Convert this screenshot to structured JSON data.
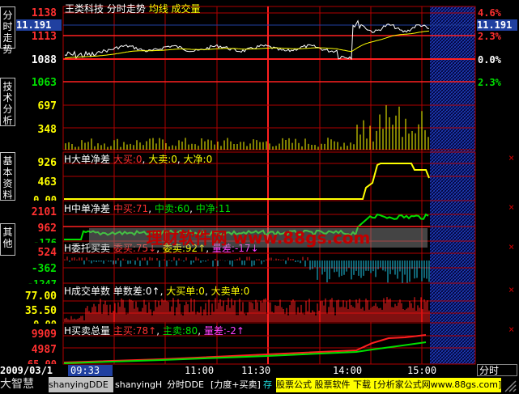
{
  "header": {
    "stock_name": "王类科技",
    "tab_timeshare": "分时走势",
    "legend_avg": "均线",
    "legend_volume": "成交量",
    "top_price": "1138",
    "top_pct": "4.6%",
    "cursor_price_left": "11.191",
    "cursor_price_right": "11.191"
  },
  "side_tabs": [
    {
      "label": "分时走势"
    },
    {
      "label": "技术分析"
    },
    {
      "label": "基本资料"
    },
    {
      "label": "其他"
    }
  ],
  "price_panel": {
    "y_labels": [
      "1113",
      "1088",
      "1063"
    ],
    "right_labels": [
      "2.3%",
      "0.0%",
      "2.3%"
    ],
    "colors": {
      "up": "#ff3030",
      "flat": "#ffffff",
      "down": "#00e000"
    }
  },
  "volume_panel": {
    "y_labels": [
      "697",
      "348"
    ]
  },
  "indicators": {
    "big_net": {
      "title": "H大单净差",
      "items": [
        {
          "label": "大买:",
          "value": "0"
        },
        {
          "label": "大卖:",
          "value": "0"
        },
        {
          "label": "大净:",
          "value": "0"
        }
      ],
      "y_labels": [
        "926",
        "463",
        "0.00"
      ]
    },
    "mid_net": {
      "title": "H中单净差",
      "items": [
        {
          "label": "中买:",
          "value": "71"
        },
        {
          "label": "中卖:",
          "value": "60"
        },
        {
          "label": "中净:",
          "value": "11"
        }
      ],
      "y_labels": [
        "2101",
        "962",
        "-176"
      ]
    },
    "entrust": {
      "title": "H委托买卖",
      "items": [
        {
          "label": "委买:",
          "value": "75↓"
        },
        {
          "label": "委卖:",
          "value": "92↑"
        },
        {
          "label": "量差:",
          "value": "-17↓"
        }
      ],
      "y_labels": [
        "524",
        "-362",
        "-1247"
      ]
    },
    "deal_count": {
      "title": "H成交单数",
      "items": [
        {
          "label": "单数差:",
          "value": "0↑"
        },
        {
          "label": "大买单:",
          "value": "0"
        },
        {
          "label": "大卖单:",
          "value": "0"
        }
      ],
      "y_labels": [
        "77.00",
        "35.50",
        "0.00"
      ]
    },
    "total_vol": {
      "title": "H买卖总量",
      "items": [
        {
          "label": "主买:",
          "value": "78↑"
        },
        {
          "label": "主卖:",
          "value": "80"
        },
        {
          "label": "量差:",
          "value": "-2↑"
        }
      ],
      "y_labels": [
        "9909",
        "4987",
        "65.00"
      ]
    }
  },
  "watermark": "理财软件网 www.88gs.com",
  "time_axis": {
    "date": "2009/03/1",
    "cursor_time": "09:33",
    "ticks": [
      "11:00",
      "11:30",
      "14:00",
      "15:00"
    ],
    "right_tab": "分时"
  },
  "bottom_tabs": [
    {
      "label": "大智慧"
    },
    {
      "label": "shanyingDDE"
    },
    {
      "label": "shanyingH"
    },
    {
      "label": "分时DDE"
    },
    {
      "label": "[力度+买卖]"
    },
    {
      "label": "存"
    }
  ],
  "ad_banner": {
    "text": "股票公式 股票软件 下载 [分析家公式网www.88gs.com]"
  },
  "colors": {
    "grid": "#b00000",
    "price_line": "#ffffff",
    "avg_line": "#ffff00",
    "volume_bar": "#ffff00",
    "positive_bar": "#ff2020",
    "negative_bar": "#20c8e8",
    "mid_line": "#00e000",
    "accent_blue": "#2040a0"
  }
}
